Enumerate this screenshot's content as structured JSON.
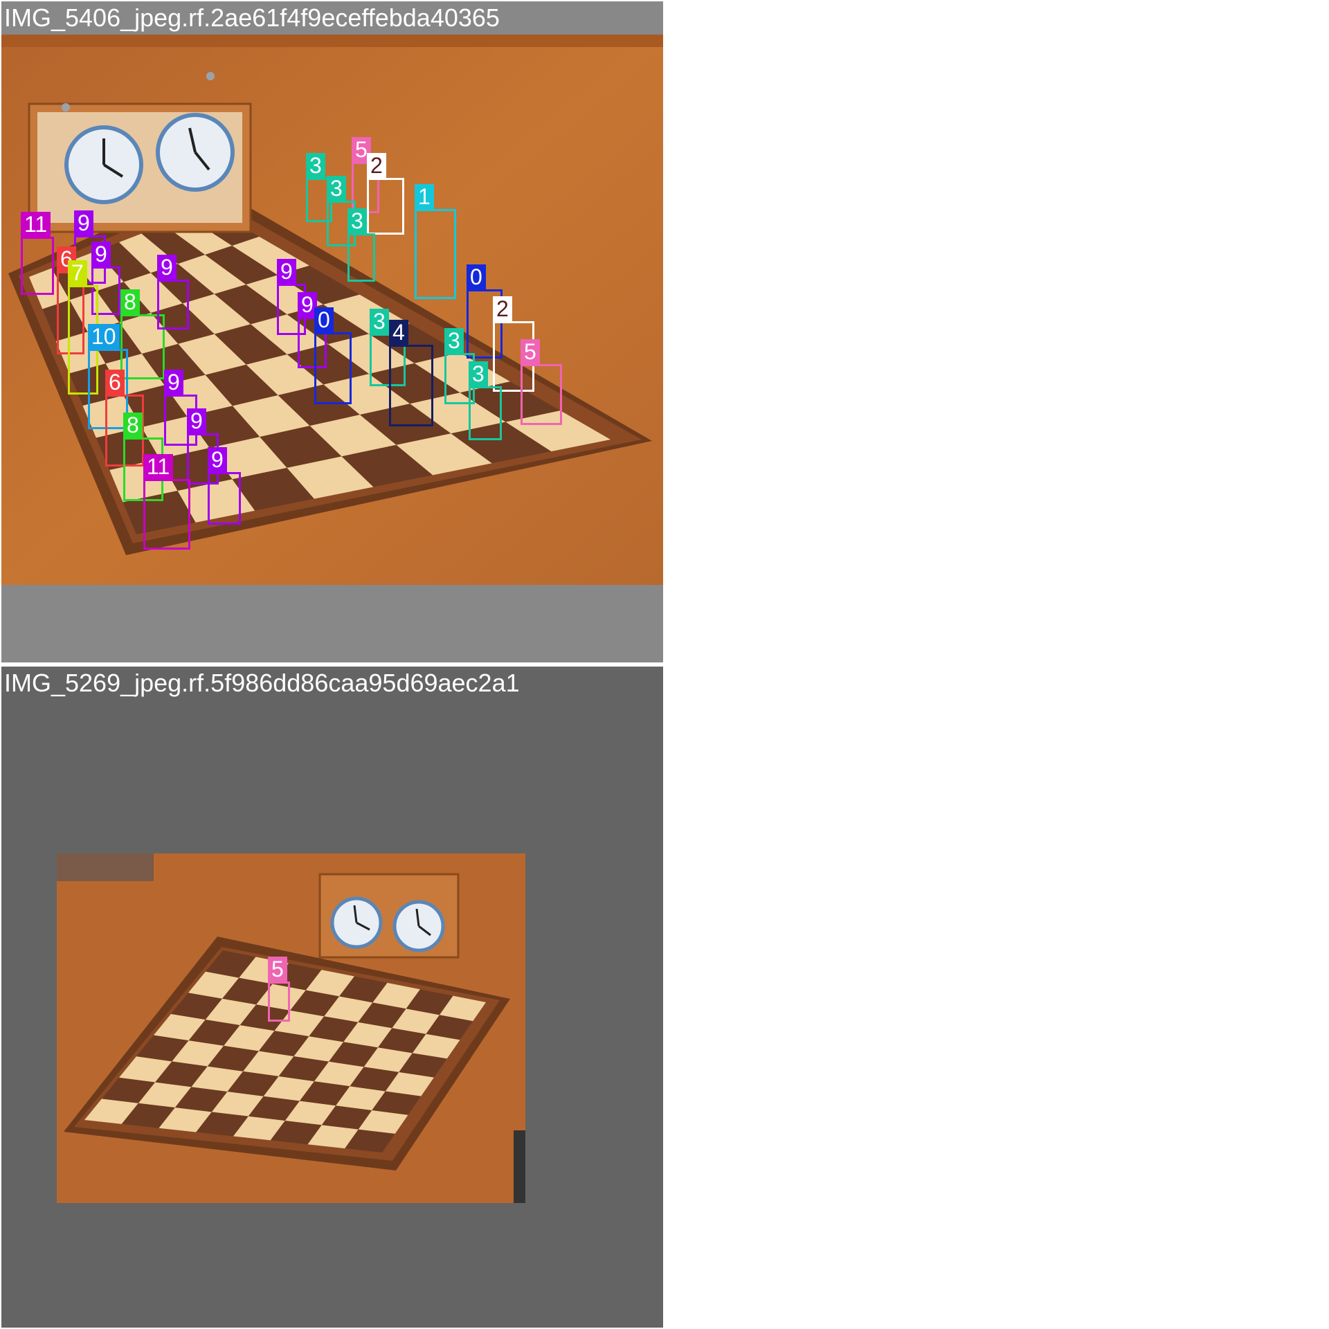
{
  "panels": [
    {
      "title": "IMG_5406_jpeg.rf.2ae61f4f9eceffebda40365",
      "detections": [
        {
          "label": "11",
          "color": "#C800C8"
        },
        {
          "label": "9",
          "color": "#A000F0"
        },
        {
          "label": "9",
          "color": "#A000F0"
        },
        {
          "label": "6",
          "color": "#F03C3C"
        },
        {
          "label": "7",
          "color": "#C8E600"
        },
        {
          "label": "8",
          "color": "#28DC28"
        },
        {
          "label": "9",
          "color": "#A000F0"
        },
        {
          "label": "10",
          "color": "#14A0E6"
        },
        {
          "label": "6",
          "color": "#F03C3C"
        },
        {
          "label": "9",
          "color": "#A000F0"
        },
        {
          "label": "8",
          "color": "#28DC28"
        },
        {
          "label": "9",
          "color": "#A000F0"
        },
        {
          "label": "11",
          "color": "#C800C8"
        },
        {
          "label": "9",
          "color": "#A000F0"
        },
        {
          "label": "3",
          "color": "#14C8A0"
        },
        {
          "label": "5",
          "color": "#F064B4"
        },
        {
          "label": "2",
          "color": "#FFFFFF"
        },
        {
          "label": "3",
          "color": "#14C8A0"
        },
        {
          "label": "3",
          "color": "#14C8A0"
        },
        {
          "label": "1",
          "color": "#14C8DC"
        },
        {
          "label": "9",
          "color": "#A000F0"
        },
        {
          "label": "9",
          "color": "#A000F0"
        },
        {
          "label": "0",
          "color": "#1428DC"
        },
        {
          "label": "3",
          "color": "#14C8A0"
        },
        {
          "label": "4",
          "color": "#141E64"
        },
        {
          "label": "0",
          "color": "#1428DC"
        },
        {
          "label": "2",
          "color": "#FFFFFF"
        },
        {
          "label": "3",
          "color": "#14C8A0"
        },
        {
          "label": "5",
          "color": "#F064B4"
        },
        {
          "label": "3",
          "color": "#14C8A0"
        }
      ]
    },
    {
      "title": "IMG_5269_jpeg.rf.5f986dd86caa95d69aec2a1",
      "detections": [
        {
          "label": "5",
          "color": "#F064B4"
        }
      ]
    }
  ]
}
